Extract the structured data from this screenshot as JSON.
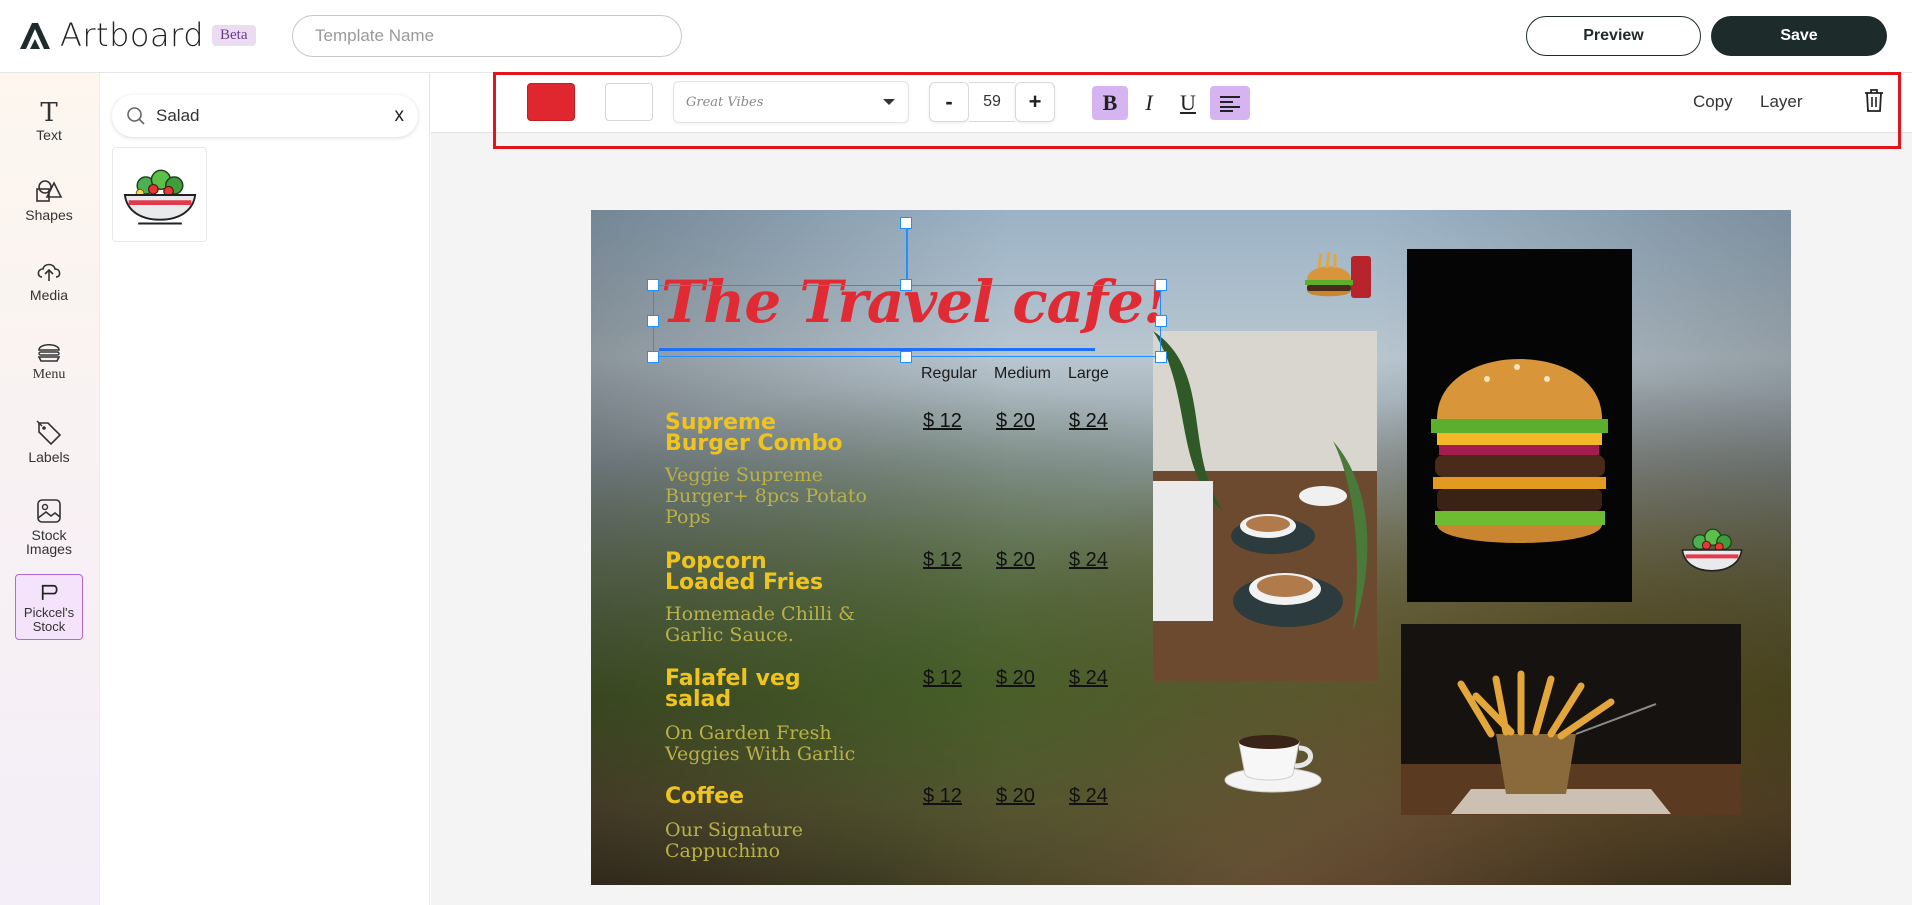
{
  "header": {
    "logo_text": "Artboard",
    "beta_label": "Beta",
    "template_name_placeholder": "Template Name",
    "template_name_value": "",
    "preview_label": "Preview",
    "save_label": "Save"
  },
  "rail": {
    "items": [
      {
        "label": "Text",
        "icon": "text-icon"
      },
      {
        "label": "Shapes",
        "icon": "shapes-icon"
      },
      {
        "label": "Media",
        "icon": "upload-cloud-icon"
      },
      {
        "label": "Menu",
        "icon": "burger-icon"
      },
      {
        "label": "Labels",
        "icon": "tag-icon"
      },
      {
        "label": "Stock Images",
        "icon": "image-icon"
      },
      {
        "label": "Pickcel's Stock",
        "icon": "pickcel-icon"
      }
    ]
  },
  "panel": {
    "search_value": "Salad",
    "clear_label": "x",
    "results": [
      {
        "icon": "salad-bowl-icon"
      }
    ]
  },
  "toolbar": {
    "text_color": "#e0262e",
    "bg_color": "#ffffff",
    "font_name": "Great Vibes",
    "minus_label": "-",
    "font_size": "59",
    "plus_label": "+",
    "bold_label": "B",
    "italic_label": "I",
    "underline_label": "U",
    "copy_label": "Copy",
    "layer_label": "Layer"
  },
  "canvas": {
    "title": "The Travel cafe!",
    "sizes": [
      "Regular",
      "Medium",
      "Large"
    ],
    "items": [
      {
        "name_line1": "Supreme",
        "name_line2": "Burger Combo",
        "desc_line1": "Veggie Supreme",
        "desc_line2": "Burger+ 8pcs Potato",
        "desc_line3": "Pops",
        "prices": [
          "$ 12",
          "$ 20",
          "$ 24"
        ]
      },
      {
        "name_line1": "Popcorn",
        "name_line2": "Loaded Fries",
        "desc_line1": "Homemade Chilli &",
        "desc_line2": "Garlic Sauce.",
        "desc_line3": "",
        "prices": [
          "$ 12",
          "$ 20",
          "$ 24"
        ]
      },
      {
        "name_line1": "Falafel veg",
        "name_line2": "salad",
        "desc_line1": "On Garden Fresh",
        "desc_line2": "Veggies With Garlic",
        "desc_line3": "",
        "prices": [
          "$ 12",
          "$ 20",
          "$ 24"
        ]
      },
      {
        "name_line1": "Coffee",
        "name_line2": "",
        "desc_line1": "Our Signature",
        "desc_line2": "Cappuchino",
        "desc_line3": "",
        "prices": [
          "$ 12",
          "$ 20",
          "$ 24"
        ]
      }
    ],
    "accent_color": "#f0c41f",
    "desc_color": "#b9b14a",
    "title_color": "#e02a34",
    "selection_color": "#1e90ff"
  }
}
